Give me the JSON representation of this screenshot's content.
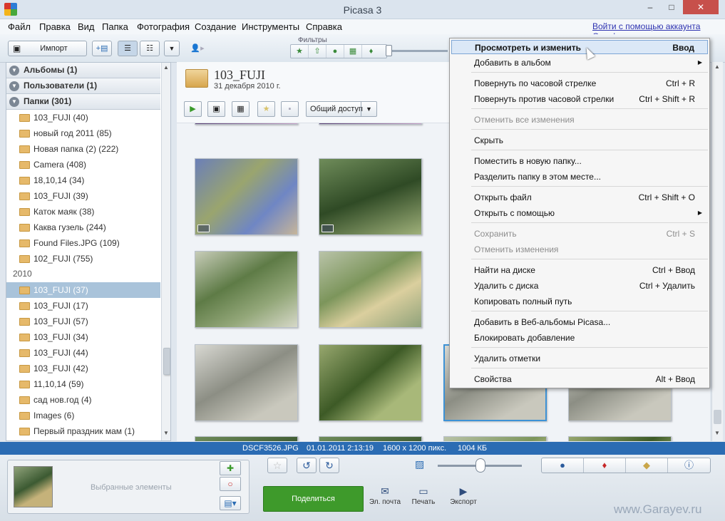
{
  "window": {
    "title": "Picasa 3",
    "min": "–",
    "max": "□",
    "close": "✕"
  },
  "menubar": {
    "items": [
      "Файл",
      "Правка",
      "Вид",
      "Папка",
      "Фотография",
      "Создание",
      "Инструменты",
      "Справка"
    ],
    "signin": "Войти с помощью аккаунта Google"
  },
  "toolbar": {
    "import_label": "Импорт",
    "filters_label": "Фильтры"
  },
  "left_panel": {
    "groups": [
      {
        "label": "Альбомы (1)"
      },
      {
        "label": "Пользователи (1)"
      },
      {
        "label": "Папки (301)"
      }
    ],
    "folders_top": [
      "103_FUJI (40)",
      "новый год 2011 (85)",
      "Новая папка (2) (222)",
      "Camera (408)",
      "18,10,14 (34)",
      "103_FUJI (39)",
      "Каток маяк (38)",
      "Каква гузель (244)",
      "Found Files.JPG (109)",
      "102_FUJI (755)"
    ],
    "year": "2010",
    "folders_year": [
      "103_FUJI (37)",
      "103_FUJI (17)",
      "103_FUJI (57)",
      "103_FUJI (34)",
      "103_FUJI (44)",
      "103_FUJI (42)",
      "11,10,14 (59)",
      "сад нов.год (4)",
      "Images (6)",
      "Первый праздник мам (1)"
    ],
    "selected_index": 0
  },
  "folder_header": {
    "name": "103_FUJI",
    "date": "31 декабря 2010 г.",
    "share_label": "Общий доступ"
  },
  "context_menu": {
    "items": [
      {
        "label": "Просмотреть и изменить",
        "shortcut": "Ввод",
        "highlighted": true
      },
      {
        "label": "Добавить в альбом",
        "shortcut": "",
        "submenu": true
      },
      {
        "label": "Повернуть по часовой стрелке",
        "shortcut": "Ctrl + R"
      },
      {
        "label": "Повернуть против часовой стрелки",
        "shortcut": "Ctrl + Shift + R"
      },
      {
        "label": "Отменить все изменения",
        "shortcut": "",
        "disabled": true
      },
      {
        "label": "Скрыть",
        "shortcut": ""
      },
      {
        "label": "Поместить в новую папку...",
        "shortcut": ""
      },
      {
        "label": "Разделить папку в этом месте...",
        "shortcut": ""
      },
      {
        "label": "Открыть файл",
        "shortcut": "Ctrl + Shift + O"
      },
      {
        "label": "Открыть с помощью",
        "shortcut": "",
        "submenu": true
      },
      {
        "label": "Сохранить",
        "shortcut": "Ctrl + S",
        "disabled": true
      },
      {
        "label": "Отменить изменения",
        "shortcut": "",
        "disabled": true
      },
      {
        "label": "Найти на диске",
        "shortcut": "Ctrl + Ввод"
      },
      {
        "label": "Удалить с диска",
        "shortcut": "Ctrl + Удалить"
      },
      {
        "label": "Копировать полный путь",
        "shortcut": ""
      },
      {
        "label": "Добавить в Веб-альбомы Picasa...",
        "shortcut": ""
      },
      {
        "label": "Блокировать добавление",
        "shortcut": ""
      },
      {
        "label": "Удалить отметки",
        "shortcut": ""
      },
      {
        "label": "Свойства",
        "shortcut": "Alt + Ввод"
      }
    ]
  },
  "statusbar": {
    "filename": "DSCF3526.JPG",
    "datetime": "01.01.2011 2:13:19",
    "dimensions": "1600 x 1200 пикс.",
    "size": "1004 КБ"
  },
  "tray": {
    "selected_label": "Выбранные элементы",
    "share_button": "Поделиться",
    "email_label": "Эл. почта",
    "print_label": "Печать",
    "export_label": "Экспорт"
  },
  "watermark": "www.Garayev.ru",
  "colors": {
    "accent": "#2b6cb3",
    "share_green": "#3e9a2b",
    "selection": "#a9c3da"
  }
}
